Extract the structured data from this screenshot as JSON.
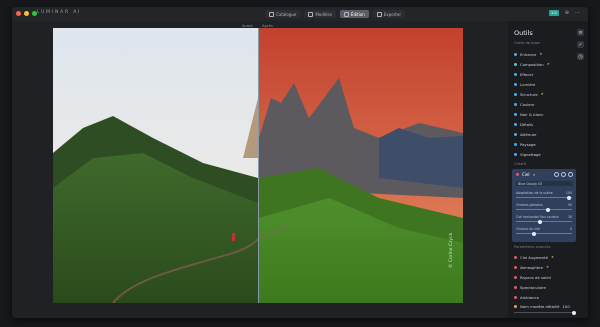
{
  "app": {
    "logo": "LUMINAR AI",
    "tabs": [
      {
        "label": "Catalogue",
        "active": false
      },
      {
        "label": "Modèles",
        "active": false
      },
      {
        "label": "Édition",
        "active": true
      },
      {
        "label": "Exporter",
        "active": false
      }
    ],
    "top_right": {
      "chip": "2.0"
    }
  },
  "canvas": {
    "before_label": "Avant",
    "after_label": "Après",
    "watermark": "© Corina Czyck"
  },
  "panel": {
    "title": "Outils",
    "section_essentials": "Outils de base",
    "tools": [
      {
        "label": "Enhance",
        "color": "#3fb0e8",
        "starred": true
      },
      {
        "label": "Composition",
        "color": "#5ac8b8",
        "starred": true
      },
      {
        "label": "Effacer",
        "color": "#3fb0e8",
        "starred": false
      },
      {
        "label": "Lumière",
        "color": "#3fb0e8",
        "starred": false
      },
      {
        "label": "Structure",
        "color": "#3fb0e8",
        "starred": true
      },
      {
        "label": "Couleur",
        "color": "#3fb0e8",
        "starred": false
      },
      {
        "label": "Noir & blanc",
        "color": "#3fb0e8",
        "starred": false
      },
      {
        "label": "Détails",
        "color": "#3fb0e8",
        "starred": false
      },
      {
        "label": "Atténuer",
        "color": "#3fb0e8",
        "starred": false
      },
      {
        "label": "Paysage",
        "color": "#3fb0e8",
        "starred": false
      },
      {
        "label": "Vignettage",
        "color": "#3fb0e8",
        "starred": false
      }
    ],
    "section_creative": "Créatif",
    "active_tool": {
      "label": "Ciel",
      "starred": true,
      "select_value": "Blue Cloudy 03",
      "sliders": [
        {
          "label": "Adaptation de la scène",
          "value": 100,
          "fraction": 0.95
        },
        {
          "label": "Ombres globales",
          "value": 50,
          "fraction": 0.55
        },
        {
          "label": "Ciel horizontal flou couleur",
          "value": 30,
          "fraction": 0.4
        },
        {
          "label": "Chaleur du ciel",
          "value": 0,
          "fraction": 0.3
        }
      ]
    },
    "section_more": "Paramètres avancés",
    "creative_tools": [
      {
        "label": "Ciel Augmenté",
        "color": "#e05d5d",
        "starred": true
      },
      {
        "label": "Atmosphère",
        "color": "#e05d5d",
        "starred": true
      },
      {
        "label": "Rayons de soleil",
        "color": "#e05d5d",
        "starred": false
      },
      {
        "label": "Spectaculaire",
        "color": "#e05d5d",
        "starred": false
      },
      {
        "label": "Ambiance",
        "color": "#e05d5d",
        "starred": false
      }
    ],
    "bottom": {
      "label": "Nom modèle détaillé",
      "value": 100
    }
  }
}
